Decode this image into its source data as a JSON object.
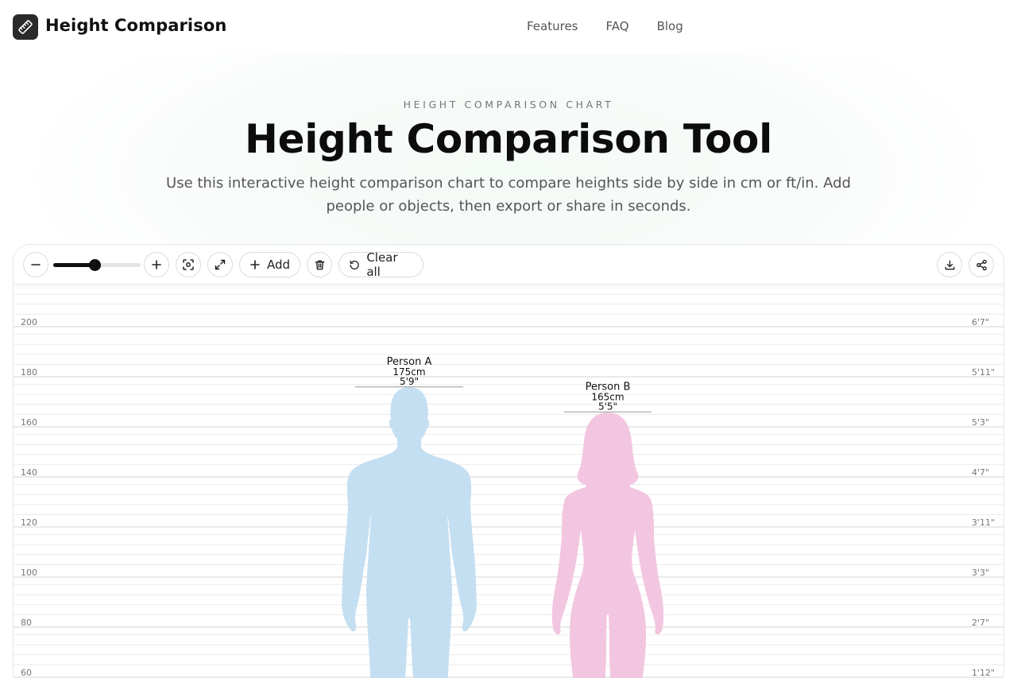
{
  "header": {
    "brand": "Height Comparison",
    "logo_icon": "ruler-icon",
    "nav": [
      {
        "label": "Features"
      },
      {
        "label": "FAQ"
      },
      {
        "label": "Blog"
      }
    ]
  },
  "hero": {
    "eyebrow": "HEIGHT COMPARISON CHART",
    "title": "Height Comparison Tool",
    "subtitle": "Use this interactive height comparison chart to compare heights side by side in cm or ft/in. Add people or objects, then export or share in seconds."
  },
  "toolbar": {
    "add_label": "Add",
    "clear_label": "Clear all",
    "zoom_level": 0.47,
    "icons": [
      "minus-icon",
      "plus-icon",
      "focus-icon",
      "expand-icon",
      "plus-icon",
      "trash-icon",
      "reset-icon",
      "download-icon",
      "share-icon"
    ]
  },
  "chart_data": {
    "type": "height-comparison",
    "cm_ticks": [
      "200",
      "180",
      "160",
      "140",
      "120",
      "100",
      "80",
      "60"
    ],
    "ft_ticks": [
      "6'7\"",
      "5'11\"",
      "5'3\"",
      "4'7\"",
      "3'11\"",
      "3'3\"",
      "2'7\"",
      "1'12\""
    ],
    "people": [
      {
        "name": "Person A",
        "height_cm": "175cm",
        "height_ft": "5'9\"",
        "value": 175,
        "color": "#c5dff2"
      },
      {
        "name": "Person B",
        "height_cm": "165cm",
        "height_ft": "5'5\"",
        "value": 165,
        "color": "#f2c6e0"
      }
    ]
  }
}
